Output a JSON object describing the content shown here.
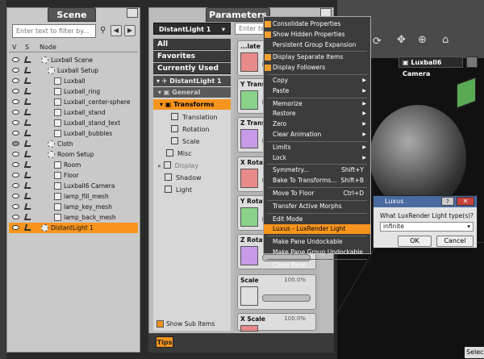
{
  "scene": {
    "title": "Scene",
    "filter_placeholder": "Enter text to filter by...",
    "cols": {
      "v": "V",
      "s": "S",
      "node": "Node"
    },
    "rows": [
      {
        "label": "Luxball Scene",
        "indent": 1,
        "vis": true
      },
      {
        "label": "Luxball Setup",
        "indent": 2,
        "vis": true
      },
      {
        "label": "Luxball",
        "indent": 3,
        "vis": true
      },
      {
        "label": "Luxball_ring",
        "indent": 3,
        "vis": true
      },
      {
        "label": "Luxball_center-sphere",
        "indent": 3,
        "vis": true
      },
      {
        "label": "Luxball_stand",
        "indent": 3,
        "vis": true
      },
      {
        "label": "Luxball_stand_text",
        "indent": 3,
        "vis": true
      },
      {
        "label": "Luxball_bubbles",
        "indent": 3,
        "vis": true
      },
      {
        "label": "Cloth",
        "indent": 2,
        "vis": false
      },
      {
        "label": "Room Setup",
        "indent": 2,
        "vis": true
      },
      {
        "label": "Room",
        "indent": 3,
        "vis": true
      },
      {
        "label": "Floor",
        "indent": 3,
        "vis": true
      },
      {
        "label": "Luxball6 Camera",
        "indent": 3,
        "vis": true
      },
      {
        "label": "lamp_fill_mesh",
        "indent": 3,
        "vis": true
      },
      {
        "label": "lamp_key_mesh",
        "indent": 3,
        "vis": true
      },
      {
        "label": "lamp_back_mesh",
        "indent": 3,
        "vis": true
      },
      {
        "label": "DistantLight 1",
        "indent": 1,
        "vis": true,
        "selected": true
      }
    ]
  },
  "params": {
    "title": "Parameters",
    "dropdown": "DistantLight 1",
    "filter_placeholder": "Enter text",
    "categories": [
      "All",
      "Favorites",
      "Currently Used"
    ],
    "tree": {
      "node": "DistantLight 1",
      "general": "General",
      "transforms": "Transforms",
      "translation": "Translation",
      "rotation": "Rotation",
      "scale": "Scale",
      "misc": "Misc",
      "display": "Display",
      "shadow": "Shadow",
      "light": "Light"
    },
    "show_sub_items": "Show Sub Items",
    "tips": "Tips",
    "cards": [
      {
        "title": "...late",
        "color": "#e88a8a"
      },
      {
        "title": "Y Transl",
        "color": "#8ad28a"
      },
      {
        "title": "Z Transl",
        "color": "#c79ae8"
      },
      {
        "title": "X Rotate",
        "color": "#e88a8a"
      },
      {
        "title": "Y Rotate",
        "color": "#8ad28a"
      },
      {
        "title": "Z Rotate",
        "color": "#c79ae8"
      },
      {
        "title": "Scale",
        "color": "#e0e0e0",
        "value": "100.0%"
      },
      {
        "title": "X Scale",
        "color": "#e88a8a",
        "value": "100.0%"
      }
    ]
  },
  "menu": {
    "items": [
      {
        "label": "Consolidate Properties",
        "check": true
      },
      {
        "label": "Show Hidden Properties",
        "check": true
      },
      {
        "label": "Persistent Group Expansion",
        "check": false
      },
      {
        "sep": true
      },
      {
        "label": "Display Separate Items",
        "check": true
      },
      {
        "label": "Display Followers",
        "check": true
      },
      {
        "sep": true
      },
      {
        "label": "Copy",
        "arrow": true
      },
      {
        "label": "Paste",
        "arrow": true
      },
      {
        "sep": true
      },
      {
        "label": "Memorize",
        "arrow": true
      },
      {
        "label": "Restore",
        "arrow": true
      },
      {
        "label": "Zero",
        "arrow": true
      },
      {
        "label": "Clear Animation",
        "arrow": true
      },
      {
        "sep": true
      },
      {
        "label": "Limits",
        "arrow": true
      },
      {
        "label": "Lock",
        "arrow": true
      },
      {
        "sep": true
      },
      {
        "label": "Symmetry...",
        "shortcut": "Shift+Y"
      },
      {
        "label": "Bake To Transforms...",
        "shortcut": "Shift+B"
      },
      {
        "sep": true
      },
      {
        "label": "Move To Floor",
        "shortcut": "Ctrl+D"
      },
      {
        "sep": true
      },
      {
        "label": "Transfer Active Morphs"
      },
      {
        "sep": true
      },
      {
        "label": "Edit Mode"
      },
      {
        "label": "Luxus - LuxRender Light",
        "highlight": true
      },
      {
        "sep": true
      },
      {
        "label": "Make Pane Undockable"
      },
      {
        "label": "Make Pane Group Undockable"
      },
      {
        "sep": true
      },
      {
        "label": "Close Pane"
      }
    ]
  },
  "viewport": {
    "camera": "Luxball6 Camera",
    "select": "Selec"
  },
  "dialog": {
    "title": "Luxus",
    "help": "?",
    "question": "What LuxRender Light type(s)?",
    "value": "infinite",
    "ok": "OK",
    "cancel": "Cancel"
  },
  "colors": {
    "accent": "#f7941d",
    "panel": "#c9c9c9",
    "menu": "#3c3c3c"
  }
}
